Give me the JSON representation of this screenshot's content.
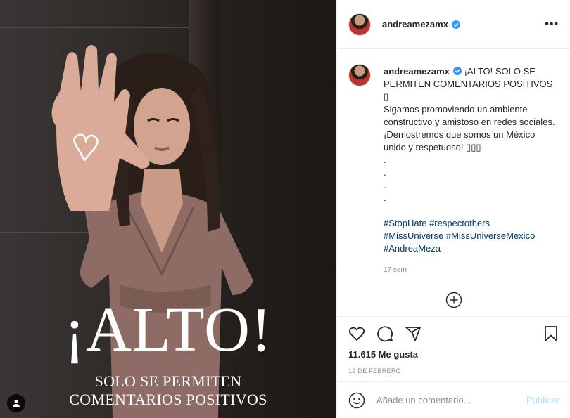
{
  "post": {
    "username": "andreamezamx",
    "more_label": "•••",
    "image_text": {
      "headline": "¡ALTO!",
      "line1": "SOLO SE PERMITEN",
      "line2": "COMENTARIOS POSITIVOS"
    },
    "caption": {
      "username": "andreamezamx",
      "title": "¡ALTO! SOLO SE PERMITEN COMENTARIOS POSITIVOS",
      "emoji1": "▯",
      "body": "Sigamos promoviendo un ambiente constructivo y amistoso en redes sociales. ¡Demostremos que somos un México unido y respetuoso! ▯▯▯",
      "dots": [
        ".",
        ".",
        ".",
        "."
      ],
      "hashtags_line1": [
        "#StopHate",
        "#respectothers"
      ],
      "hashtags_line2": [
        "#MissUniverse",
        "#MissUniverseMexico"
      ],
      "hashtags_line3": [
        "#AndreaMeza"
      ],
      "time": "17 sem"
    },
    "likes": "11.615 Me gusta",
    "date": "19 DE FEBRERO",
    "comment_placeholder": "Añade un comentario...",
    "publish_label": "Publicar"
  },
  "colors": {
    "link": "#00376b",
    "verified": "#3897f0",
    "publish_disabled": "#b2dffc"
  },
  "icons": [
    "user-tag-icon",
    "verified-icon",
    "more-icon",
    "load-more-icon",
    "heart-icon",
    "comment-icon",
    "share-icon",
    "bookmark-icon",
    "emoji-icon"
  ]
}
